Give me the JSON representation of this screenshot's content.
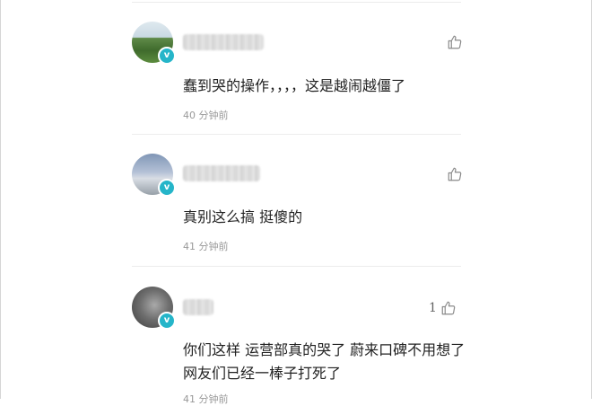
{
  "comments": [
    {
      "text": "蠢到哭的操作，，，，这是越闹越僵了",
      "time": "40 分钟前",
      "likes": "",
      "verified_mark": "v"
    },
    {
      "text": "真别这么搞 挺傻的",
      "time": "41 分钟前",
      "likes": "",
      "verified_mark": "v"
    },
    {
      "text": "你们这样 运营部真的哭了 蔚来口碑不用想了 网友们已经一棒子打死了",
      "time": "41 分钟前",
      "likes": "1",
      "verified_mark": "v"
    }
  ],
  "colors": {
    "verified_badge": "#25b5c9",
    "time_text": "#999999",
    "divider": "#ececec"
  },
  "icons": {
    "like": "thumbs-up-outline-icon",
    "verified": "verified-v-badge-icon"
  }
}
